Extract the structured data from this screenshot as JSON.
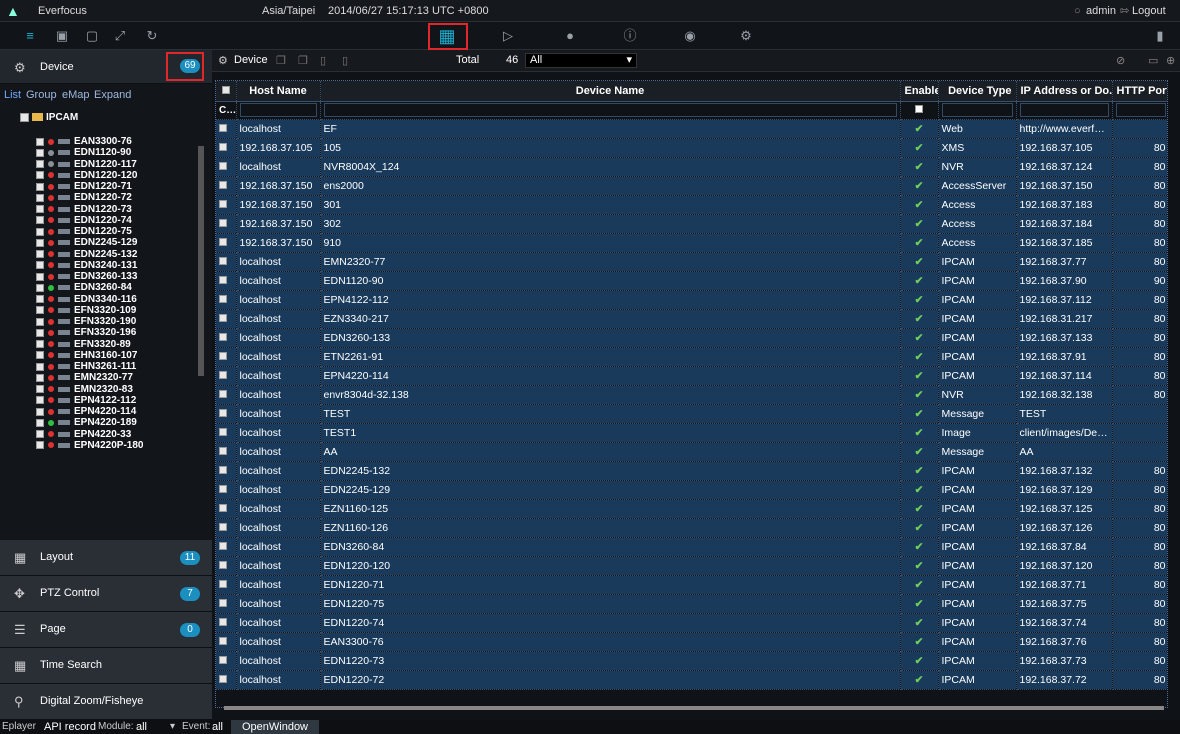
{
  "titlebar": {
    "app": "Everfocus",
    "timezone": "Asia/Taipei",
    "datetime": "2014/06/27 15:17:13",
    "utc": "UTC +0800",
    "user": "admin",
    "logout": "Logout"
  },
  "left": {
    "device_label": "Device",
    "device_count": "69",
    "subtabs": [
      "List",
      "Group",
      "eMap",
      "Expand"
    ],
    "tree_root": "IPCAM",
    "tree_items": [
      {
        "name": "EAN3300-76",
        "status": "red"
      },
      {
        "name": "EDN1120-90",
        "status": "gray"
      },
      {
        "name": "EDN1220-117",
        "status": "gray"
      },
      {
        "name": "EDN1220-120",
        "status": "red"
      },
      {
        "name": "EDN1220-71",
        "status": "red"
      },
      {
        "name": "EDN1220-72",
        "status": "red"
      },
      {
        "name": "EDN1220-73",
        "status": "red"
      },
      {
        "name": "EDN1220-74",
        "status": "red"
      },
      {
        "name": "EDN1220-75",
        "status": "red"
      },
      {
        "name": "EDN2245-129",
        "status": "red"
      },
      {
        "name": "EDN2245-132",
        "status": "red"
      },
      {
        "name": "EDN3240-131",
        "status": "red"
      },
      {
        "name": "EDN3260-133",
        "status": "red"
      },
      {
        "name": "EDN3260-84",
        "status": "green"
      },
      {
        "name": "EDN3340-116",
        "status": "red"
      },
      {
        "name": "EFN3320-109",
        "status": "red"
      },
      {
        "name": "EFN3320-190",
        "status": "red"
      },
      {
        "name": "EFN3320-196",
        "status": "red"
      },
      {
        "name": "EFN3320-89",
        "status": "red"
      },
      {
        "name": "EHN3160-107",
        "status": "red"
      },
      {
        "name": "EHN3261-111",
        "status": "red"
      },
      {
        "name": "EMN2320-77",
        "status": "red"
      },
      {
        "name": "EMN2320-83",
        "status": "red"
      },
      {
        "name": "EPN4122-112",
        "status": "red"
      },
      {
        "name": "EPN4220-114",
        "status": "red"
      },
      {
        "name": "EPN4220-189",
        "status": "green"
      },
      {
        "name": "EPN4220-33",
        "status": "red"
      },
      {
        "name": "EPN4220P-180",
        "status": "red"
      }
    ],
    "sections": [
      {
        "label": "Layout",
        "badge": "11",
        "icon": "layout-icon"
      },
      {
        "label": "PTZ Control",
        "badge": "7",
        "icon": "ptz-icon"
      },
      {
        "label": "Page",
        "badge": "0",
        "icon": "page-icon"
      },
      {
        "label": "Time Search",
        "badge": "",
        "icon": "calendar-icon"
      },
      {
        "label": "Digital Zoom/Fisheye",
        "badge": "",
        "icon": "zoom-icon"
      }
    ]
  },
  "main": {
    "header": {
      "title": "Device",
      "total_label": "Total",
      "total_value": "46",
      "filter_value": "All"
    },
    "columns": [
      "Host Name",
      "Device Name",
      "Enable",
      "Device Type",
      "IP Address or Do...",
      "HTTP Port"
    ],
    "filter_label": "Cls",
    "rows": [
      [
        "localhost",
        "EF",
        "Web",
        "http://www.everfoc...",
        ""
      ],
      [
        "192.168.37.105",
        "105",
        "XMS",
        "192.168.37.105",
        "80"
      ],
      [
        "localhost",
        "NVR8004X_124",
        "NVR",
        "192.168.37.124",
        "80"
      ],
      [
        "192.168.37.150",
        "ens2000",
        "AccessServer",
        "192.168.37.150",
        "80"
      ],
      [
        "192.168.37.150",
        "301",
        "Access",
        "192.168.37.183",
        "80"
      ],
      [
        "192.168.37.150",
        "302",
        "Access",
        "192.168.37.184",
        "80"
      ],
      [
        "192.168.37.150",
        "910",
        "Access",
        "192.168.37.185",
        "80"
      ],
      [
        "localhost",
        "EMN2320-77",
        "IPCAM",
        "192.168.37.77",
        "80"
      ],
      [
        "localhost",
        "EDN1120-90",
        "IPCAM",
        "192.168.37.90",
        "90"
      ],
      [
        "localhost",
        "EPN4122-112",
        "IPCAM",
        "192.168.37.112",
        "80"
      ],
      [
        "localhost",
        "EZN3340-217",
        "IPCAM",
        "192.168.31.217",
        "80"
      ],
      [
        "localhost",
        "EDN3260-133",
        "IPCAM",
        "192.168.37.133",
        "80"
      ],
      [
        "localhost",
        "ETN2261-91",
        "IPCAM",
        "192.168.37.91",
        "80"
      ],
      [
        "localhost",
        "EPN4220-114",
        "IPCAM",
        "192.168.37.114",
        "80"
      ],
      [
        "localhost",
        "envr8304d-32.138",
        "NVR",
        "192.168.32.138",
        "80"
      ],
      [
        "localhost",
        "TEST",
        "Message",
        "TEST",
        ""
      ],
      [
        "localhost",
        "TEST1",
        "Image",
        "client/images/Devi...",
        ""
      ],
      [
        "localhost",
        "AA",
        "Message",
        "AA",
        ""
      ],
      [
        "localhost",
        "EDN2245-132",
        "IPCAM",
        "192.168.37.132",
        "80"
      ],
      [
        "localhost",
        "EDN2245-129",
        "IPCAM",
        "192.168.37.129",
        "80"
      ],
      [
        "localhost",
        "EZN1160-125",
        "IPCAM",
        "192.168.37.125",
        "80"
      ],
      [
        "localhost",
        "EZN1160-126",
        "IPCAM",
        "192.168.37.126",
        "80"
      ],
      [
        "localhost",
        "EDN3260-84",
        "IPCAM",
        "192.168.37.84",
        "80"
      ],
      [
        "localhost",
        "EDN1220-120",
        "IPCAM",
        "192.168.37.120",
        "80"
      ],
      [
        "localhost",
        "EDN1220-71",
        "IPCAM",
        "192.168.37.71",
        "80"
      ],
      [
        "localhost",
        "EDN1220-75",
        "IPCAM",
        "192.168.37.75",
        "80"
      ],
      [
        "localhost",
        "EDN1220-74",
        "IPCAM",
        "192.168.37.74",
        "80"
      ],
      [
        "localhost",
        "EAN3300-76",
        "IPCAM",
        "192.168.37.76",
        "80"
      ],
      [
        "localhost",
        "EDN1220-73",
        "IPCAM",
        "192.168.37.73",
        "80"
      ],
      [
        "localhost",
        "EDN1220-72",
        "IPCAM",
        "192.168.37.72",
        "80"
      ]
    ]
  },
  "bottom": {
    "eplayer": "Eplayer",
    "api": "API record",
    "module_label": "Module:",
    "module_value": "all",
    "event_label": "Event:",
    "event_value": "all",
    "openwindow": "OpenWindow"
  },
  "colors": {
    "row_bg": "#193a5a",
    "accent": "#1a8fc0",
    "highlight": "#e0282a",
    "check": "#6fcf5a"
  }
}
